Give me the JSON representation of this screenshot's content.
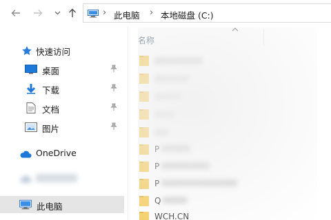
{
  "navigation": {
    "back_icon": "arrow-left-icon",
    "forward_icon": "arrow-right-icon",
    "recent_icon": "chevron-down-icon",
    "up_icon": "arrow-up-icon"
  },
  "address_bar": {
    "crumbs": [
      "此电脑",
      "本地磁盘 (C:)"
    ],
    "separator": "›"
  },
  "sidebar": {
    "items": [
      {
        "label": "快速访问",
        "icon": "star-icon"
      },
      {
        "label": "桌面",
        "icon": "desktop-icon",
        "pinned": true
      },
      {
        "label": "下载",
        "icon": "download-icon",
        "pinned": true
      },
      {
        "label": "文档",
        "icon": "document-icon",
        "pinned": true
      },
      {
        "label": "图片",
        "icon": "picture-icon",
        "pinned": true
      },
      {
        "label": "OneDrive",
        "icon": "cloud-icon"
      },
      {
        "label": "",
        "icon": "cloud-icon",
        "blurred": true
      },
      {
        "label": "此电脑",
        "icon": "pc-icon",
        "selected": true
      }
    ]
  },
  "file_list": {
    "column_header": "名称",
    "sort_icon": "chevron-up-icon",
    "rows": [
      {
        "name": "",
        "blurred": true
      },
      {
        "name": "",
        "blurred": true
      },
      {
        "name": "",
        "blurred": true
      },
      {
        "name": "",
        "blurred": true
      },
      {
        "name": "",
        "blurred": true
      },
      {
        "name_visible": "P",
        "blurred_tail": true
      },
      {
        "name_visible": "P",
        "blurred_tail": true
      },
      {
        "name_visible": "P",
        "blurred_tail": true
      },
      {
        "name_visible": "Q",
        "blurred_tail": true
      },
      {
        "name_visible": "WCH.CN",
        "blurred_tail": false
      }
    ]
  },
  "colors": {
    "folder": "#f5c84b",
    "folder_dark": "#e0a92a",
    "selected_bg": "#e5e5e5",
    "header_text": "#4c607a",
    "accent_blue": "#1e88e5"
  }
}
